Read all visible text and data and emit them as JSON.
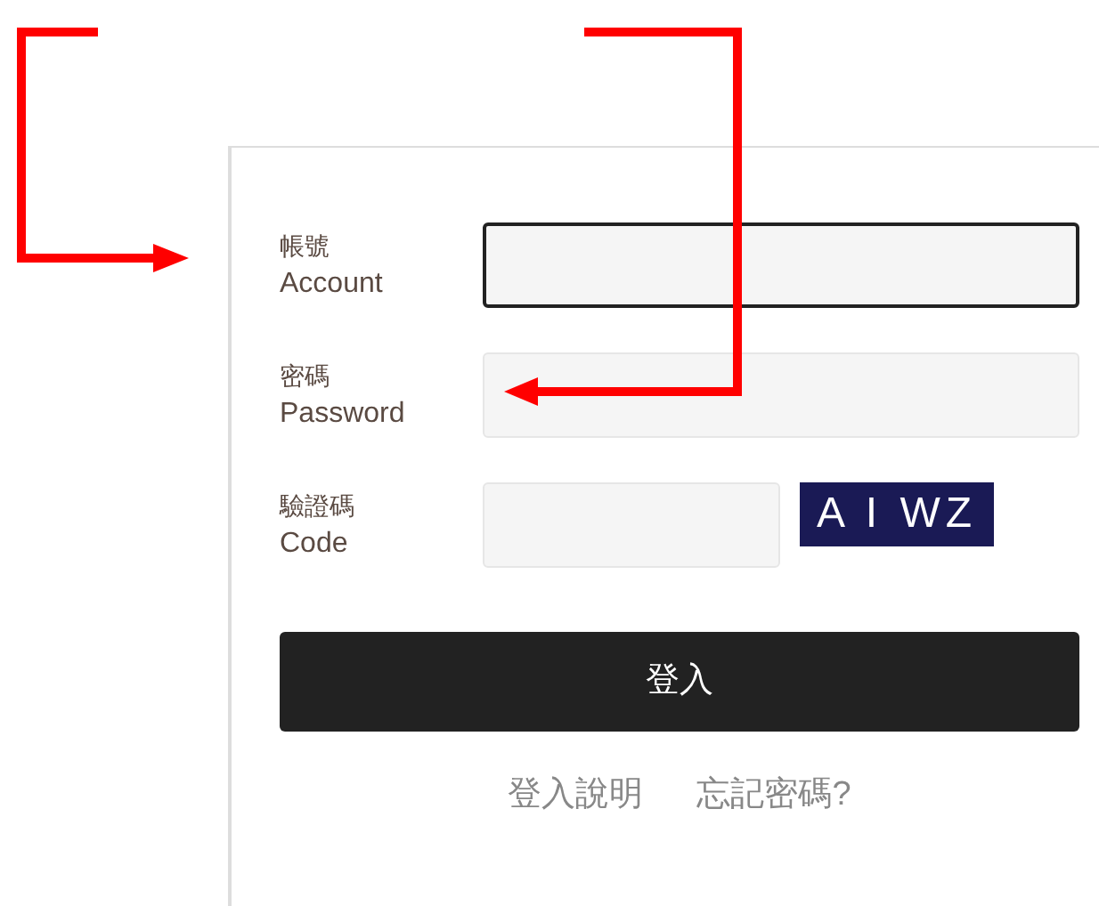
{
  "fields": [
    {
      "label_zh": "帳號",
      "label_en": "Account",
      "kind": "text",
      "focused": true
    },
    {
      "label_zh": "密碼",
      "label_en": "Password",
      "kind": "password",
      "focused": false
    },
    {
      "label_zh": "驗證碼",
      "label_en": "Code",
      "kind": "captcha",
      "focused": false,
      "captcha": "A I WZ"
    }
  ],
  "login_button": "登入",
  "links": [
    "登入說明",
    "忘記密碼?"
  ]
}
